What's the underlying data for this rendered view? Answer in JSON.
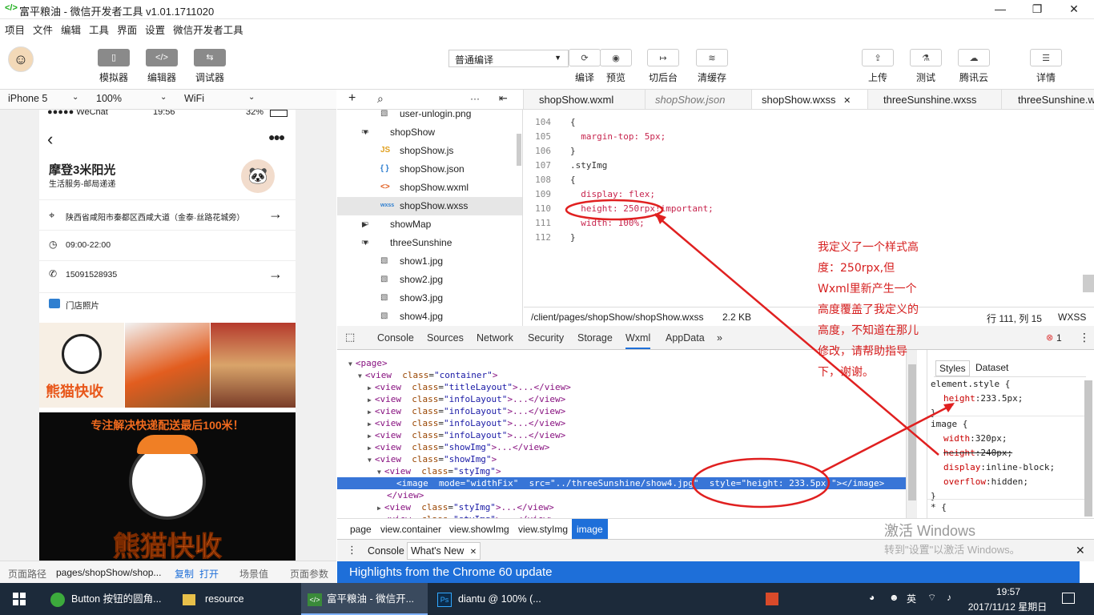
{
  "window": {
    "title": "富平粮油 - 微信开发者工具 v1.01.1711020",
    "min": "—",
    "max": "❐",
    "close": "✕"
  },
  "menu": [
    "项目",
    "文件",
    "编辑",
    "工具",
    "界面",
    "设置",
    "微信开发者工具"
  ],
  "toolbar": {
    "left": [
      {
        "label": "模拟器",
        "glyph": "▯"
      },
      {
        "label": "编辑器",
        "glyph": "</>"
      },
      {
        "label": "调试器",
        "glyph": "⇆"
      }
    ],
    "compile_mode": "普通编译",
    "right": [
      {
        "label": "编译",
        "glyph": "⟳"
      },
      {
        "label": "预览",
        "glyph": "◉"
      },
      {
        "label": "切后台",
        "glyph": "↦"
      },
      {
        "label": "清缓存",
        "glyph": "≋"
      },
      {
        "label": "上传",
        "glyph": "⇪"
      },
      {
        "label": "测试",
        "glyph": "⚗"
      },
      {
        "label": "腾讯云",
        "glyph": "☁"
      },
      {
        "label": "详情",
        "glyph": "☰"
      }
    ]
  },
  "device": {
    "model": "iPhone 5",
    "zoom": "100%",
    "network": "WiFi"
  },
  "phone": {
    "status_left": "●●●●● WeChat",
    "status_time": "19:56",
    "status_battery": "32%",
    "shop_name": "摩登3米阳光",
    "shop_sub": "生活服务-邮局递递",
    "address": "陕西省咸阳市秦都区西咸大道（金泰·丝路花城旁）",
    "hours": "09:00-22:00",
    "phone": "15091528935",
    "photos_label": "门店照片",
    "banner_text": "专注解决快递配送最后100米！",
    "logo_text": "熊猫快收"
  },
  "tree": [
    {
      "label": "user-unlogin.png",
      "icon": "img"
    },
    {
      "label": "shopShow",
      "icon": "folder",
      "open": true
    },
    {
      "label": "shopShow.js",
      "icon": "js"
    },
    {
      "label": "shopShow.json",
      "icon": "json"
    },
    {
      "label": "shopShow.wxml",
      "icon": "wxml"
    },
    {
      "label": "shopShow.wxss",
      "icon": "wxss",
      "selected": true
    },
    {
      "label": "showMap",
      "icon": "folder",
      "open": false
    },
    {
      "label": "threeSunshine",
      "icon": "folder",
      "open": true
    },
    {
      "label": "show1.jpg",
      "icon": "img"
    },
    {
      "label": "show2.jpg",
      "icon": "img"
    },
    {
      "label": "show3.jpg",
      "icon": "img"
    },
    {
      "label": "show4.jpg",
      "icon": "img"
    }
  ],
  "tree_tools": {
    "add": "+",
    "search": "⌕",
    "more": "···",
    "collapse": "⇤"
  },
  "tabs": [
    {
      "label": "shopShow.wxml"
    },
    {
      "label": "shopShow.json",
      "italic": true
    },
    {
      "label": "shopShow.wxss",
      "active": true,
      "close": "✕"
    },
    {
      "label": "threeSunshine.wxss"
    },
    {
      "label": "threeSunshine.w"
    }
  ],
  "code": [
    {
      "n": "104",
      "t": "{"
    },
    {
      "n": "105",
      "t": "  margin-top: 5px;"
    },
    {
      "n": "106",
      "t": "}"
    },
    {
      "n": "107",
      "t": ".styImg"
    },
    {
      "n": "108",
      "t": "{"
    },
    {
      "n": "109",
      "t": "  display: flex;"
    },
    {
      "n": "110",
      "t": "  height: 250rpx!important;"
    },
    {
      "n": "111",
      "t": "  width: 100%;"
    },
    {
      "n": "112",
      "t": "}"
    }
  ],
  "editor_status": {
    "path": "/client/pages/shopShow/shopShow.wxss",
    "size": "2.2 KB",
    "pos": "行 111, 列 15",
    "lang": "WXSS"
  },
  "devtools_tabs": [
    {
      "label": "Console"
    },
    {
      "label": "Sources"
    },
    {
      "label": "Network"
    },
    {
      "label": "Security"
    },
    {
      "label": "Storage"
    },
    {
      "label": "Wxml",
      "active": true
    },
    {
      "label": "AppData"
    },
    {
      "label": "»"
    }
  ],
  "error_count": "1",
  "wxml": [
    {
      "indent": 0,
      "arrow": "▼",
      "html": "<page>"
    },
    {
      "indent": 1,
      "arrow": "▼",
      "tag": "view",
      "cls": "container",
      "end": ">"
    },
    {
      "indent": 2,
      "arrow": "▶",
      "tag": "view",
      "cls": "titleLayout",
      "end": ">...</view>"
    },
    {
      "indent": 2,
      "arrow": "▶",
      "tag": "view",
      "cls": "infoLayout",
      "end": ">...</view>"
    },
    {
      "indent": 2,
      "arrow": "▶",
      "tag": "view",
      "cls": "infoLayout",
      "end": ">...</view>"
    },
    {
      "indent": 2,
      "arrow": "▶",
      "tag": "view",
      "cls": "infoLayout",
      "end": ">...</view>"
    },
    {
      "indent": 2,
      "arrow": "▶",
      "tag": "view",
      "cls": "infoLayout",
      "end": ">...</view>"
    },
    {
      "indent": 2,
      "arrow": "▶",
      "tag": "view",
      "cls": "showImg",
      "end": ">...</view>"
    },
    {
      "indent": 2,
      "arrow": "▼",
      "tag": "view",
      "cls": "showImg",
      "end": ">"
    },
    {
      "indent": 3,
      "arrow": "▼",
      "tag": "view",
      "cls": "styImg",
      "end": ">"
    },
    {
      "indent": 4,
      "arrow": "",
      "selected": true,
      "html": "<image  mode=\"widthFix\"  src=\"../threeSunshine/show4.jpg\"  style=\"height: 233.5px;\"></image>"
    },
    {
      "indent": 3,
      "arrow": "",
      "html": "</view>"
    },
    {
      "indent": 3,
      "arrow": "▶",
      "tag": "view",
      "cls": "styImg",
      "end": ">...</view>"
    },
    {
      "indent": 3,
      "arrow": "▶",
      "tag": "view",
      "cls": "styImg",
      "end": ">...</view>"
    }
  ],
  "styles": {
    "tabs": [
      "Styles",
      "Dataset"
    ],
    "rules": [
      {
        "sel": "element.style {",
        "props": [
          {
            "k": "height",
            "v": "233.5px;"
          }
        ],
        "close": "}"
      },
      {
        "sel": "image {",
        "props": [
          {
            "k": "width",
            "v": "320px;"
          },
          {
            "k": "height",
            "v": "240px;",
            "strike": true
          },
          {
            "k": "display",
            "v": "inline-block;"
          },
          {
            "k": "overflow",
            "v": "hidden;"
          }
        ],
        "close": "}"
      },
      {
        "sel": "* {",
        "props": [],
        "close": ""
      }
    ]
  },
  "breadcrumbs": [
    "page",
    "view.container",
    "view.showImg",
    "view.styImg",
    "image"
  ],
  "drawer": {
    "tabs": [
      "Console",
      "What's New"
    ],
    "close": "✕",
    "headline": "Highlights from the Chrome 60 update"
  },
  "status": {
    "route_label": "页面路径",
    "route": "pages/shopShow/shop...",
    "copy": "复制",
    "open": "打开",
    "scene": "场景值",
    "params": "页面参数"
  },
  "annotation": [
    "我定义了一个样式高",
    "度：250rpx,但",
    "Wxml里新产生一个",
    "高度覆盖了我定义的",
    "高度，不知道在那儿",
    "修改，请帮助指导",
    "下，谢谢。"
  ],
  "watermark": {
    "line1": "激活 Windows",
    "line2": "转到\"设置\"以激活 Windows。"
  },
  "taskbar": {
    "items": [
      {
        "label": "Button 按钮的圆角..."
      },
      {
        "label": "resource"
      },
      {
        "label": "富平粮油 - 微信开...",
        "active": true
      },
      {
        "label": "diantu @ 100% (..."
      }
    ],
    "time": "19:57",
    "date": "2017/11/12 星期日",
    "tray": "英"
  },
  "colors": {
    "accent": "#1e6fd9",
    "annotation": "#d62020",
    "selection": "#3875d7"
  }
}
